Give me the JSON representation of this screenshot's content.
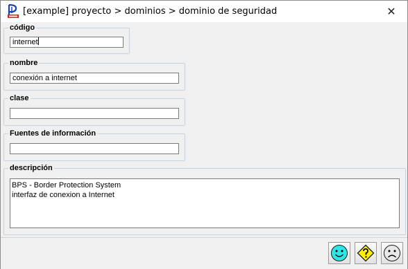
{
  "window": {
    "title": "[example] proyecto > dominios > dominio de seguridad",
    "close_glyph": "✕"
  },
  "form": {
    "codigo": {
      "label": "código",
      "value": "internet"
    },
    "nombre": {
      "label": "nombre",
      "value": "conexión a internet"
    },
    "clase": {
      "label": "clase",
      "value": ""
    },
    "fuentes": {
      "label": "Fuentes de información",
      "value": ""
    },
    "descripcion": {
      "label": "descripción",
      "lines": [
        "BPS - Border Protection System",
        "interfaz de conexion a Internet"
      ]
    }
  },
  "buttons": [
    {
      "icon": "smiley-happy-icon",
      "color": "#2ee6e6"
    },
    {
      "icon": "help-diamond-icon",
      "color": "#ffee00"
    },
    {
      "icon": "smiley-sad-icon",
      "color": "#e8e8e8"
    }
  ]
}
